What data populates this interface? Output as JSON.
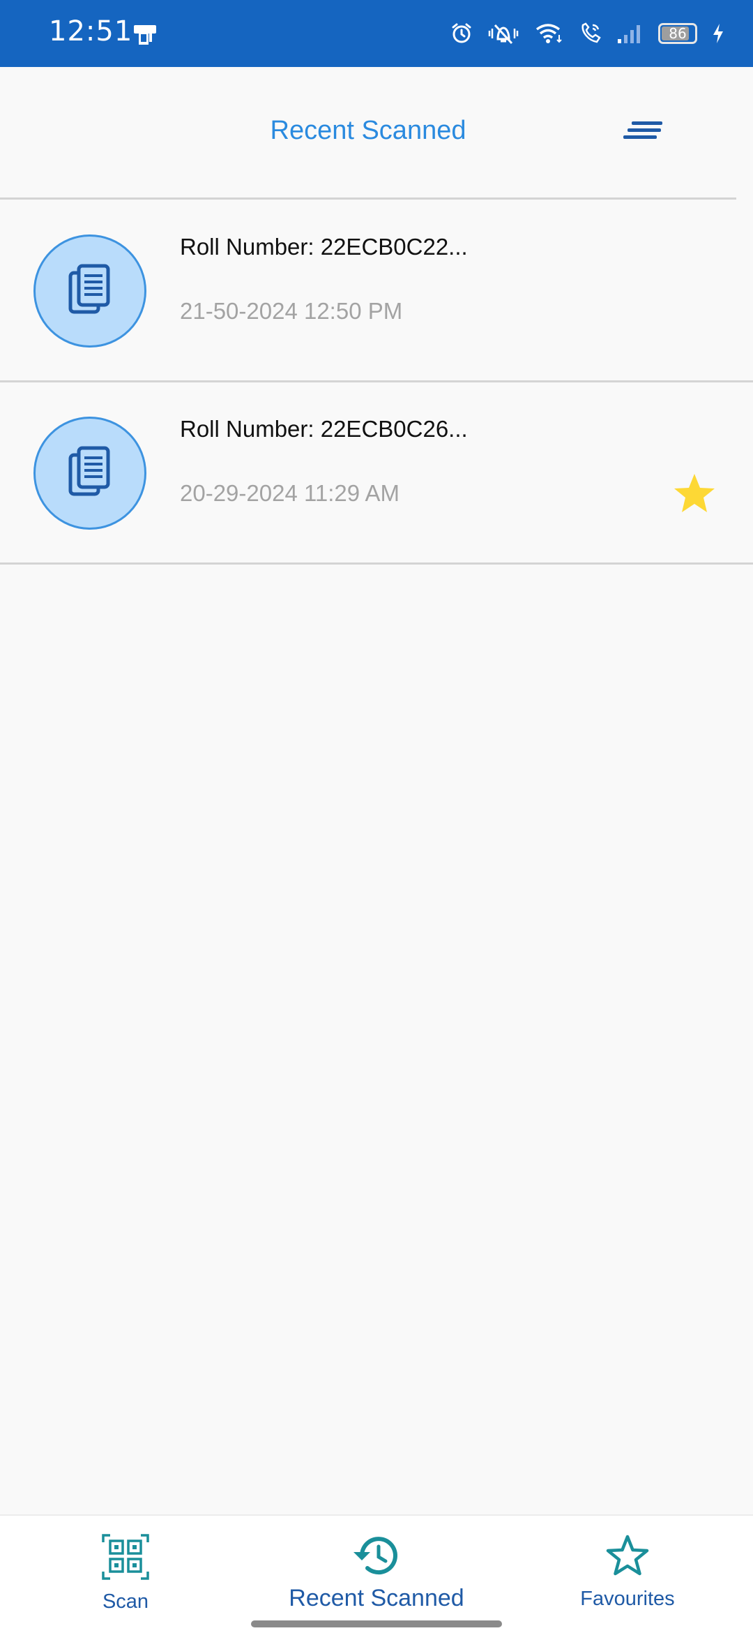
{
  "status_bar": {
    "time": "12:51",
    "battery_level": "86",
    "battery_percent": 86,
    "icons": [
      "alarm-icon",
      "vibrate-off-icon",
      "wifi-icon",
      "wifi-calling-icon",
      "signal-icon",
      "battery-icon",
      "charging-icon"
    ]
  },
  "header": {
    "title": "Recent Scanned",
    "sort_icon": "sort-lines-icon"
  },
  "scans": [
    {
      "title": "Roll Number: 22ECB0C22...",
      "date": "21-50-2024 12:50 PM",
      "favourite": false,
      "icon": "document-copy-icon"
    },
    {
      "title": "Roll Number: 22ECB0C26...",
      "date": "20-29-2024 11:29 AM",
      "favourite": true,
      "icon": "document-copy-icon"
    }
  ],
  "bottom_nav": {
    "items": [
      {
        "label": "Scan",
        "icon": "qr-code-icon",
        "active": false
      },
      {
        "label": "Recent Scanned",
        "icon": "history-icon",
        "active": true
      },
      {
        "label": "Favourites",
        "icon": "star-outline-icon",
        "active": false
      }
    ]
  },
  "colors": {
    "status_bar_bg": "#1565c0",
    "accent": "#2a8adf",
    "nav_label": "#1f5aa6",
    "nav_icon": "#1a8f9a",
    "star": "#fdd835",
    "avatar_bg": "#b9dcfb",
    "date_text": "#a3a3a3"
  }
}
